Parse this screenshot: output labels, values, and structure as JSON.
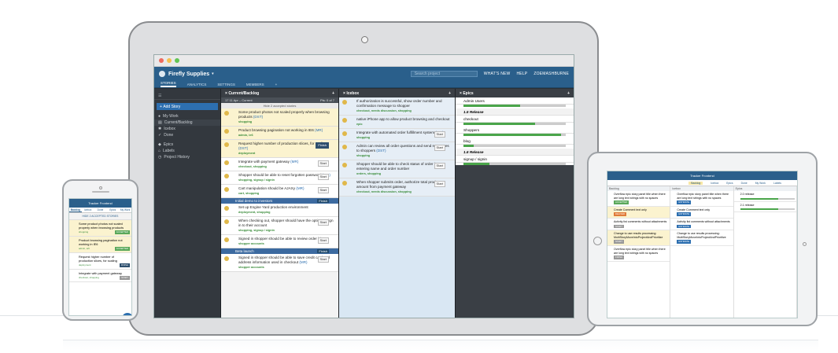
{
  "app": {
    "project_name": "Firefly Supplies",
    "search_placeholder": "Search project",
    "header_links": [
      "WHAT'S NEW",
      "HELP",
      "ZOEMASHBURNE"
    ],
    "tabs": [
      "STORIES",
      "ANALYTICS",
      "SETTINGS",
      "MEMBERS"
    ]
  },
  "sidebar": {
    "add_story": "Add Story",
    "items": [
      "My Work",
      "Current/Backlog",
      "Icebox",
      "Done",
      "Epics",
      "Labels",
      "Project History"
    ]
  },
  "backlog": {
    "title": "Current/Backlog",
    "iteration": "17   11 Apr – Current",
    "pts": "Pts: 0 of 7",
    "accepted": "Hide 2 accepted stories",
    "stories": [
      {
        "text": "Some product photos not scaled properly when browsing products",
        "id": "(DST)",
        "labels": "shopping",
        "state": "",
        "color": "yellow"
      },
      {
        "text": "Product browsing pagination not working in IE6",
        "id": "(MR)",
        "labels": "admin, ie6",
        "state": "",
        "color": "yellow"
      },
      {
        "text": "Request higher number of production slices, for scaling",
        "id": "(DST)",
        "labels": "deployment",
        "state": "Finish",
        "color": "yellow"
      },
      {
        "text": "Integrate with payment gateway",
        "id": "(MR)",
        "labels": "checkout, shopping",
        "state": "Start",
        "color": "white"
      },
      {
        "text": "Shopper should be able to reset forgotten password",
        "id": "(MR)",
        "labels": "shopping, signup / signin",
        "state": "Start",
        "color": "white"
      },
      {
        "text": "Cart manipulation should be AJAXy",
        "id": "(MR)",
        "labels": "cart, shopping",
        "state": "Start",
        "color": "white"
      }
    ],
    "release1": "Initial demo to investors",
    "release1_state": "Finish",
    "stories2": [
      {
        "text": "Set up Engine Yard production environment",
        "labels": "deployment, shopping",
        "state": "",
        "color": "white"
      },
      {
        "text": "When checking out, shopper should have the option to sign in to their account",
        "labels": "shopping, signup / signin",
        "state": "Start",
        "color": "white"
      },
      {
        "text": "Signed in shopper should be able to review order history",
        "labels": "shopper accounts",
        "state": "Start",
        "color": "white"
      }
    ],
    "release2": "Beta launch",
    "release2_state": "Finish",
    "stories3": [
      {
        "text": "Signed in shopper should be able to save credit card and address information used in checkout",
        "id": "(MR)",
        "labels": "shopper accounts",
        "state": "Start",
        "color": "white"
      }
    ]
  },
  "icebox": {
    "title": "Icebox",
    "stories": [
      {
        "text": "If authorization is successful, show order number and confirmation message to shopper",
        "labels": "checkout, needs discussion, shopping",
        "state": ""
      },
      {
        "text": "native iPhone app to allow product browsing and checkout",
        "labels": "epic",
        "state": ""
      },
      {
        "text": "Integrate with automated order fulfillment system",
        "id": "(MR)",
        "labels": "shopping",
        "state": "Start"
      },
      {
        "text": "Admin can review all order questions and send responses to shoppers",
        "id": "(DST)",
        "labels": "shopping",
        "state": "Start"
      },
      {
        "text": "Shopper should be able to check status of order by entering name and order number",
        "labels": "orders, shopping",
        "state": "Start"
      },
      {
        "text": "When shopper submits order, authorize total product amount from payment gateway",
        "labels": "checkout, needs discussion, shopping",
        "state": "Start"
      }
    ]
  },
  "epics": {
    "title": "Epics",
    "items": [
      {
        "name": "Admin Users",
        "release": false,
        "progress": 0.55
      },
      {
        "name": "1.5 Release",
        "release": true,
        "progress": null
      },
      {
        "name": "checkout",
        "release": false,
        "progress": 0.7
      },
      {
        "name": "Shoppers",
        "release": false,
        "progress": 0.95
      },
      {
        "name": "blog",
        "release": false,
        "progress": 0.1
      },
      {
        "name": "1.6 Release",
        "release": true,
        "progress": null
      },
      {
        "name": "signup / signin",
        "release": false,
        "progress": 0.25
      }
    ]
  },
  "phone": {
    "title": "Tracker Frontend",
    "tabs": [
      "Backlog",
      "Icebox",
      "Done",
      "Epics",
      "My Work"
    ],
    "accepted": "HIDE 2 ACCEPTED STORIES",
    "stories": [
      {
        "text": "Some product photos not scaled properly when browsing products",
        "labels": "shopping",
        "state": "ACCEPTED"
      },
      {
        "text": "Product browsing pagination not working in IE6",
        "labels": "admin, ie6",
        "state": "ACCEPTED"
      },
      {
        "text": "Request higher number of production slices, for scaling",
        "labels": "deployment",
        "state": "FINISH"
      },
      {
        "text": "Integrate with payment gateway",
        "labels": "checkout, shopping",
        "state": "START"
      }
    ],
    "fab": "+"
  },
  "tablet": {
    "title": "Tracker Frontend",
    "tabs": [
      "Backlog",
      "Icebox",
      "Epics",
      "Done",
      "My Work",
      "Labels"
    ],
    "columns": [
      {
        "head": "Backlog",
        "stories": [
          {
            "text": "Overflow epic story panel title when there are long text strings with no spaces",
            "state": "ACCEPTED"
          },
          {
            "text": "Create Comment text only",
            "state": "DELIVER"
          },
          {
            "text": "Activity list comments without attachments",
            "state": "START"
          },
          {
            "text": "Change to use results processing: MultiStoryMoveIntoProjectAndPrioritize",
            "state": "START"
          },
          {
            "text": "Overflow epic story panel title when there are long text strings with no spaces",
            "state": "FINISH"
          }
        ]
      },
      {
        "head": "Icebox",
        "stories": [
          {
            "text": "Overflow epic story panel title when there are long text strings with no spaces",
            "state": "ESTIMATE"
          },
          {
            "text": "Create Comment text only",
            "state": "ESTIMATE"
          },
          {
            "text": "Activity list comments without attachments",
            "state": "ESTIMATE"
          },
          {
            "text": "Change to use results processing: MultiStoryMoveIntoProjectAndPrioritize",
            "state": "ESTIMATE"
          }
        ]
      },
      {
        "head": "Epics",
        "stories": [
          {
            "text": "2.0 release",
            "state": ""
          },
          {
            "text": "2.1 release",
            "state": ""
          }
        ]
      }
    ]
  },
  "colors": {
    "brand": "#2a5f8b",
    "accent": "#2d6fb0",
    "story_yellow": "#fbf3cf",
    "sidebar": "#33383e"
  }
}
